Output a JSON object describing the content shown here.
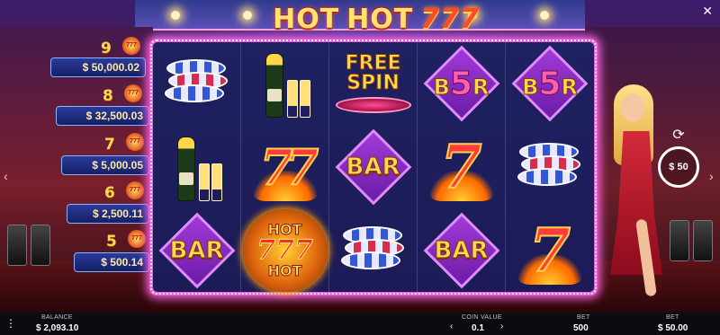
{
  "game": {
    "title_word1": "HOT",
    "title_word2": "HOT",
    "title_777": "777"
  },
  "jackpots": [
    {
      "count": "9",
      "amount": "$ 50,000.02"
    },
    {
      "count": "8",
      "amount": "$ 32,500.03"
    },
    {
      "count": "7",
      "amount": "$ 5,000.05"
    },
    {
      "count": "6",
      "amount": "$ 2,500.11"
    },
    {
      "count": "5",
      "amount": "$ 500.14"
    }
  ],
  "reels": [
    [
      "chips",
      "champagne",
      "free_spin",
      "b5r",
      "b5r"
    ],
    [
      "champagne",
      "seven_double",
      "bar",
      "seven",
      "chips"
    ],
    [
      "bar",
      "wild_hot",
      "chips",
      "bar",
      "seven"
    ]
  ],
  "symbols": {
    "free_spin_line1": "FREE",
    "free_spin_line2": "SPIN",
    "bar_label": "BAR",
    "b5r_left": "B",
    "b5r_mid": "5",
    "b5r_right": "R",
    "wild_top": "HOT",
    "wild_mid": "777",
    "wild_bottom": "HOT",
    "seven": "7",
    "seven_double": "77"
  },
  "controls": {
    "autoplay_label": "50",
    "autoplay_currency": "$",
    "spin_icon": "refresh-icon",
    "menu_icon": "menu-icon",
    "close_icon": "close-icon"
  },
  "bottom_bar": {
    "balance_label": "BALANCE",
    "balance_value": "$ 2,093.10",
    "coin_value_label": "COIN VALUE",
    "coin_value": "0.1",
    "bet_coins_label": "BET",
    "bet_coins_value": "500",
    "bet_money_label": "BET",
    "bet_money_value": "$ 50.00"
  },
  "colors": {
    "frame_accent": "#e65fd9",
    "reel_bg": "#1f2160",
    "jackpot_bg": "#2a3a9c",
    "title_yellow": "#ffe36a",
    "title_red": "#ff4b2b"
  }
}
